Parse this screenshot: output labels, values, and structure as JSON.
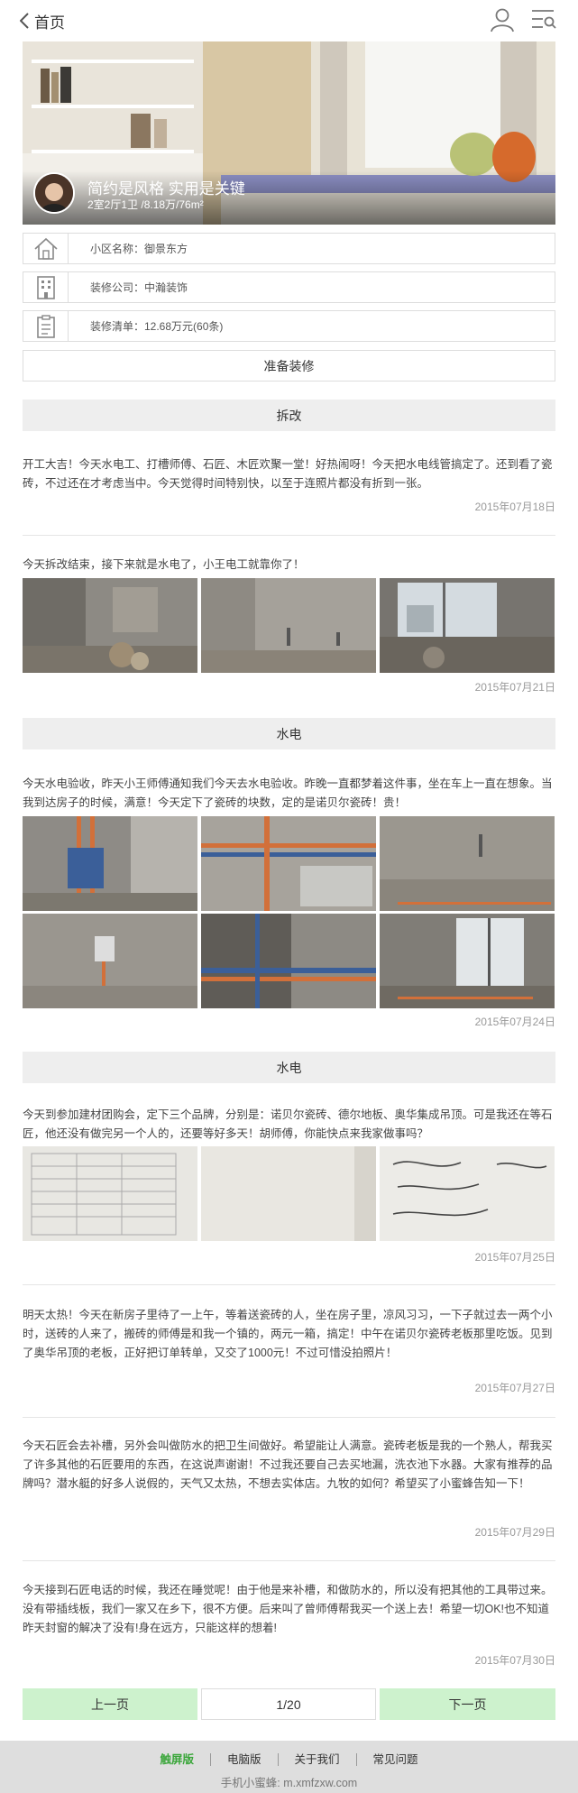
{
  "header": {
    "back_label": "首页"
  },
  "hero": {
    "title": "简约是风格 实用是关键",
    "subtitle": "2室2厅1卫 /8.18万/76m²"
  },
  "info": {
    "community": "小区名称：御景东方",
    "company": "装修公司：中瀚装饰",
    "checklist": "装修清单：12.68万元(60条)"
  },
  "prepare_button": "准备装修",
  "sections": {
    "s1": "拆改",
    "s2": "水电",
    "s3": "水电"
  },
  "entries": [
    {
      "text": "开工大吉！今天水电工、打槽师傅、石匠、木匠欢聚一堂！好热闹呀！今天把水电线管搞定了。还到看了瓷砖，不过还在才考虑当中。今天觉得时间特别快，以至于连照片都没有折到一张。",
      "date": "2015年07月18日"
    },
    {
      "text": "今天拆改结束，接下来就是水电了，小王电工就靠你了！",
      "date": "2015年07月21日"
    },
    {
      "text": "今天水电验收，昨天小王师傅通知我们今天去水电验收。昨晚一直都梦着这件事，坐在车上一直在想象。当我到达房子的时候，满意！今天定下了瓷砖的块数，定的是诺贝尔瓷砖！贵！",
      "date": "2015年07月24日"
    },
    {
      "text": "今天到参加建材团购会，定下三个品牌，分别是：诺贝尔瓷砖、德尔地板、奥华集成吊顶。可是我还在等石匠，他还没有做完另一个人的，还要等好多天！胡师傅，你能快点来我家做事吗？",
      "date": "2015年07月25日"
    },
    {
      "text": "明天太热！今天在新房子里待了一上午，等着送瓷砖的人，坐在房子里，凉风习习，一下子就过去一两个小时，送砖的人来了，搬砖的师傅是和我一个镇的，两元一箱，搞定！中午在诺贝尔瓷砖老板那里吃饭。见到了奥华吊顶的老板，正好把订单转单，又交了1000元！不过可惜没拍照片！",
      "date": "2015年07月27日"
    },
    {
      "text": "今天石匠会去补槽，另外会叫做防水的把卫生间做好。希望能让人满意。瓷砖老板是我的一个熟人，帮我买了许多其他的石匠要用的东西，在这说声谢谢！不过我还要自己去买地漏，洗衣池下水器。大家有推荐的品牌吗？潜水艇的好多人说假的，天气又太热，不想去实体店。九牧的如何？希望买了小蜜蜂告知一下！",
      "date": "2015年07月29日"
    },
    {
      "text": "今天接到石匠电话的时候，我还在睡觉呢！由于他是来补槽，和做防水的，所以没有把其他的工具带过来。没有带插线板，我们一家又在乡下，很不方便。后来叫了曾师傅帮我买一个送上去！希望一切OK!也不知道昨天封窗的解决了没有!身在远方，只能这样的想着!",
      "date": "2015年07月30日"
    }
  ],
  "pagination": {
    "prev": "上一页",
    "current": "1/20",
    "next": "下一页"
  },
  "footer": {
    "links": [
      "触屏版",
      "电脑版",
      "关于我们",
      "常见问题"
    ],
    "site": "手机小蜜蜂: m.xmfzxw.com"
  },
  "colors": {
    "accent_green": "#3aa63a",
    "pager_green": "#cdf2cd",
    "section_bg": "#eeeeee"
  }
}
